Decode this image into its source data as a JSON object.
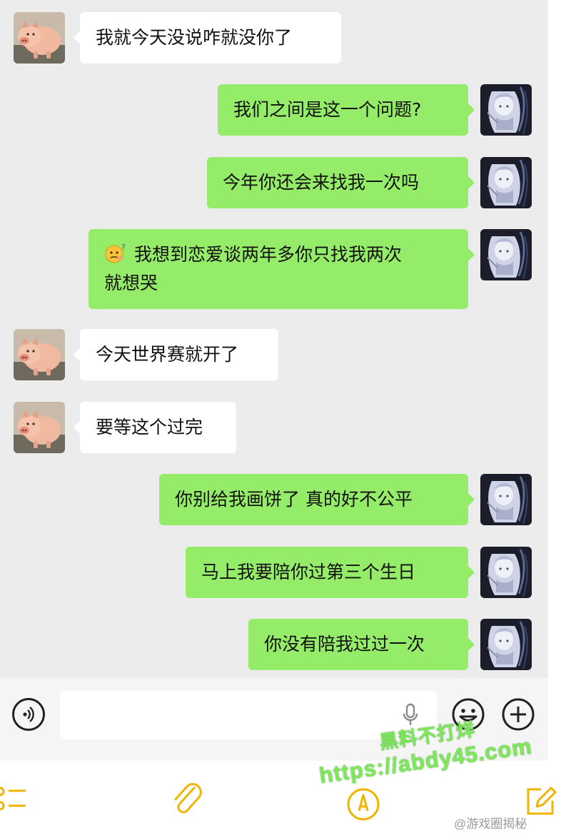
{
  "messages": [
    {
      "side": "in",
      "text": "我就今天没说咋就没你了"
    },
    {
      "side": "out",
      "text": "我们之间是这一个问题?"
    },
    {
      "side": "out",
      "text": "今年你还会来找我一次吗"
    },
    {
      "side": "out",
      "emoji": "thinking-face-emoji",
      "line1": "我想到恋爱谈两年多你只找我两次",
      "line2": "就想哭"
    },
    {
      "side": "in",
      "text": "今天世界赛就开了"
    },
    {
      "side": "in",
      "text": "要等这个过完"
    },
    {
      "side": "out",
      "text": "你别给我画饼了 真的好不公平"
    },
    {
      "side": "out",
      "text": "马上我要陪你过第三个生日"
    },
    {
      "side": "out",
      "text": "你没有陪我过过一次"
    }
  ],
  "input": {
    "value": "",
    "placeholder": ""
  },
  "icons": {
    "input_bar": [
      "voice-icon",
      "mic-icon",
      "emoji-icon",
      "plus-icon"
    ],
    "toolbar": [
      "list-icon",
      "paperclip-icon",
      "pen-circle-icon",
      "edit-icon"
    ]
  },
  "colors": {
    "outgoing_bubble": "#95ec69",
    "incoming_bubble": "#ffffff",
    "chat_background": "#ececec",
    "toolbar_accent": "#f0b400"
  },
  "watermark": {
    "line1": "黑料不打烊",
    "line2": "https://abdy45.com"
  },
  "credit": "@游戏圈揭秘"
}
